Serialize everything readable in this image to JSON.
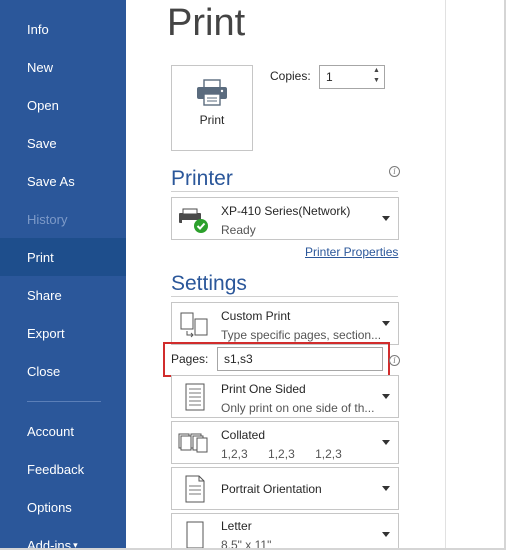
{
  "sidebar": {
    "items": [
      {
        "label": "Info"
      },
      {
        "label": "New"
      },
      {
        "label": "Open"
      },
      {
        "label": "Save"
      },
      {
        "label": "Save As"
      },
      {
        "label": "History"
      },
      {
        "label": "Print"
      },
      {
        "label": "Share"
      },
      {
        "label": "Export"
      },
      {
        "label": "Close"
      },
      {
        "label": "Account"
      },
      {
        "label": "Feedback"
      },
      {
        "label": "Options"
      },
      {
        "label": "Add-ins"
      }
    ],
    "bg_color": "#2b579a"
  },
  "main": {
    "title": "Print",
    "print_button_label": "Print",
    "copies_label": "Copies:",
    "copies_value": "1",
    "printer": {
      "section_title": "Printer",
      "name": "XP-410 Series(Network)",
      "status": "Ready",
      "properties_link": "Printer Properties"
    },
    "settings": {
      "section_title": "Settings",
      "print_range": {
        "title": "Custom Print",
        "subtitle": "Type specific pages, section..."
      },
      "pages_label": "Pages:",
      "pages_value": "s1,s3",
      "sides": {
        "title": "Print One Sided",
        "subtitle": "Only print on one side of th..."
      },
      "collation": {
        "title": "Collated",
        "values": [
          "1,2,3",
          "1,2,3",
          "1,2,3"
        ]
      },
      "orientation": {
        "title": "Portrait Orientation"
      },
      "paper": {
        "title": "Letter",
        "subtitle": "8.5\" x 11\""
      }
    }
  },
  "colors": {
    "accent": "#2b579a",
    "highlight": "#d12c2c",
    "ready": "#2ca02c"
  }
}
